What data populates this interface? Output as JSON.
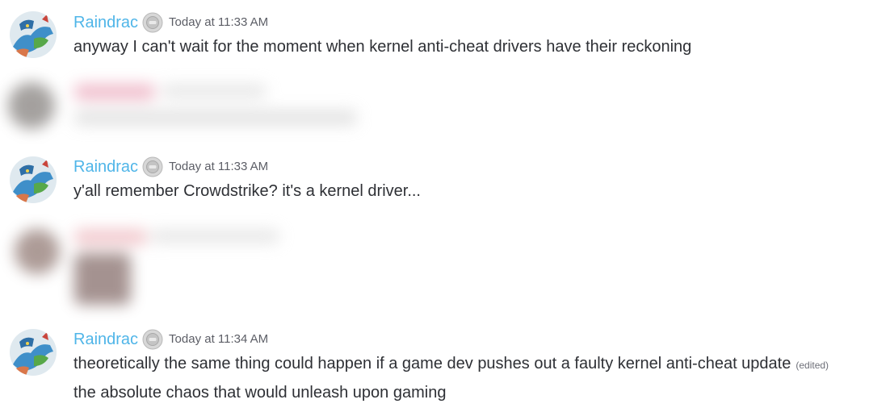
{
  "messages": [
    {
      "username": "Raindrac",
      "timestamp": "Today at 11:33 AM",
      "lines": [
        "anyway I can't wait for the moment when kernel anti-cheat drivers have their reckoning"
      ]
    },
    {
      "username": "Raindrac",
      "timestamp": "Today at 11:33 AM",
      "lines": [
        "y'all remember Crowdstrike? it's a kernel driver..."
      ]
    },
    {
      "username": "Raindrac",
      "timestamp": "Today at 11:34 AM",
      "lines": [
        "theoretically the same thing could happen if a game dev pushes out a faulty kernel anti-cheat update",
        "the absolute chaos that would unleash upon gaming"
      ],
      "edited_label": "(edited)"
    }
  ],
  "colors": {
    "username": "#4fb5e8",
    "timestamp": "#5c5e66",
    "message_text": "#2e3035",
    "background": "#ffffff"
  },
  "icons": {
    "avatar": "dragon-avatar-icon",
    "badge": "server-tag-badge-icon"
  }
}
